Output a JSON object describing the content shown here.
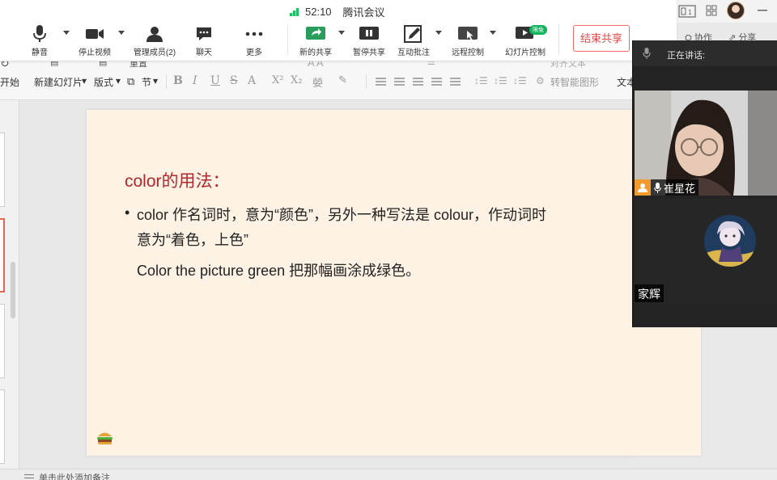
{
  "meeting": {
    "app_title": "腾讯会议",
    "duration": "52:10",
    "toolbar": {
      "mute": "静音",
      "stop_video": "停止视频",
      "manage_members": "管理成员(2)",
      "chat": "聊天",
      "more": "更多",
      "new_share": "新的共享",
      "pause_share": "暂停共享",
      "annotate": "互动批注",
      "remote_control": "远程控制",
      "slideshow_control": "幻灯片控制",
      "free_badge": "限免",
      "end_share": "结束共享"
    },
    "collab_label": "协作",
    "share_label": "分享"
  },
  "ribbon": {
    "start": "开始",
    "new_slide": "新建幻灯片",
    "layout": "版式",
    "section": "节",
    "reset": "重置",
    "convert_shape": "转智能图形",
    "text_box": "文本",
    "align_text": "对齐文本"
  },
  "slide": {
    "title": "color的用法：",
    "line1": "color 作名词时，意为“颜色”，另外一种写法是 colour，作动词时",
    "line2": "意为“着色，上色”",
    "example": "Color the picture green 把那幅画涂成绿色。",
    "bullet": "•"
  },
  "status_bar": {
    "notes_hint": "单击此处添加备注"
  },
  "video_panel": {
    "speaking_label": "正在讲话:",
    "participant1": "崔星花",
    "participant2": "家辉"
  },
  "colors": {
    "accent_green": "#19c15f",
    "end_red": "#e64646",
    "slide_bg": "#fdf2e4",
    "title_red": "#b3282d"
  }
}
